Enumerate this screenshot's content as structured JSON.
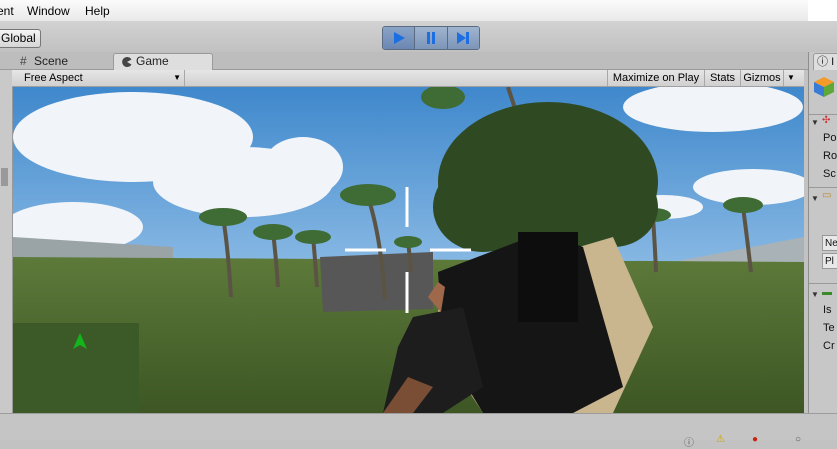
{
  "menu": {
    "items": [
      "ent",
      "Window",
      "Help"
    ]
  },
  "toolbar": {
    "global_label": "Global",
    "play_icon": "play-icon",
    "pause_icon": "pause-icon",
    "step_icon": "step-icon"
  },
  "tabs": {
    "scene": {
      "label": "Scene",
      "icon": "grid-icon"
    },
    "game": {
      "label": "Game",
      "icon": "pacman-icon"
    }
  },
  "game_toolbar": {
    "aspect": "Free Aspect",
    "maximize_label": "Maximize on Play",
    "stats_label": "Stats",
    "gizmos_label": "Gizmos"
  },
  "inspector": {
    "tab_label": "I",
    "transform_rows": [
      "Po",
      "Ro",
      "Sc"
    ],
    "box_rows": [
      "Ne",
      "Pl"
    ],
    "rigidbody_rows": [
      "Is",
      "Te",
      "Cr"
    ]
  },
  "colors": {
    "play_active": "#1b6fe0",
    "minimap_arrow": "#13b51b",
    "sky_top": "#3f88cc",
    "grass": "#4e6b2e"
  }
}
